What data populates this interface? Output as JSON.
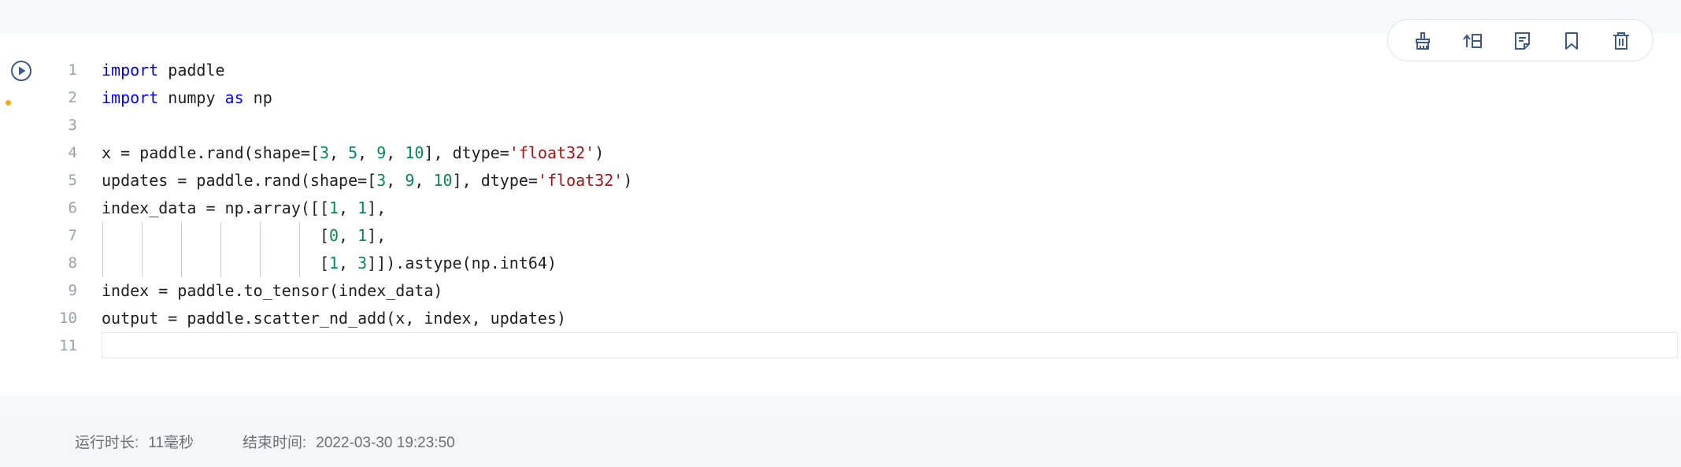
{
  "colors": {
    "accent_dot": "#f5a623",
    "icon": "#3c5a8a",
    "keyword": "#0000ff",
    "number": "#098658",
    "string": "#a31515"
  },
  "toolbar": {
    "buttons": [
      {
        "icon": "broom-icon",
        "name": "clear-output-button"
      },
      {
        "icon": "move-up-icon",
        "name": "move-cell-button"
      },
      {
        "icon": "note-icon",
        "name": "cell-notes-button"
      },
      {
        "icon": "bookmark-icon",
        "name": "bookmark-button"
      },
      {
        "icon": "trash-icon",
        "name": "delete-cell-button"
      }
    ]
  },
  "run_button": {
    "icon": "play-circle-icon"
  },
  "code": {
    "line_numbers": [
      "1",
      "2",
      "3",
      "4",
      "5",
      "6",
      "7",
      "8",
      "9",
      "10",
      "11"
    ],
    "lines": [
      [
        {
          "t": "import",
          "c": "kw"
        },
        {
          "t": " paddle",
          "c": ""
        }
      ],
      [
        {
          "t": "import",
          "c": "kw"
        },
        {
          "t": " numpy ",
          "c": ""
        },
        {
          "t": "as",
          "c": "kw"
        },
        {
          "t": " np",
          "c": ""
        }
      ],
      [],
      [
        {
          "t": "x = paddle.rand(shape=[",
          "c": ""
        },
        {
          "t": "3",
          "c": "num"
        },
        {
          "t": ", ",
          "c": ""
        },
        {
          "t": "5",
          "c": "num"
        },
        {
          "t": ", ",
          "c": ""
        },
        {
          "t": "9",
          "c": "num"
        },
        {
          "t": ", ",
          "c": ""
        },
        {
          "t": "10",
          "c": "num"
        },
        {
          "t": "], dtype=",
          "c": ""
        },
        {
          "t": "'float32'",
          "c": "str"
        },
        {
          "t": ")",
          "c": ""
        }
      ],
      [
        {
          "t": "updates = paddle.rand(shape=[",
          "c": ""
        },
        {
          "t": "3",
          "c": "num"
        },
        {
          "t": ", ",
          "c": ""
        },
        {
          "t": "9",
          "c": "num"
        },
        {
          "t": ", ",
          "c": ""
        },
        {
          "t": "10",
          "c": "num"
        },
        {
          "t": "], dtype=",
          "c": ""
        },
        {
          "t": "'float32'",
          "c": "str"
        },
        {
          "t": ")",
          "c": ""
        }
      ],
      [
        {
          "t": "index_data = np.array([[",
          "c": ""
        },
        {
          "t": "1",
          "c": "num"
        },
        {
          "t": ", ",
          "c": ""
        },
        {
          "t": "1",
          "c": "num"
        },
        {
          "t": "],",
          "c": ""
        }
      ],
      [
        {
          "t": "                       [",
          "c": ""
        },
        {
          "t": "0",
          "c": "num"
        },
        {
          "t": ", ",
          "c": ""
        },
        {
          "t": "1",
          "c": "num"
        },
        {
          "t": "],",
          "c": ""
        }
      ],
      [
        {
          "t": "                       [",
          "c": ""
        },
        {
          "t": "1",
          "c": "num"
        },
        {
          "t": ", ",
          "c": ""
        },
        {
          "t": "3",
          "c": "num"
        },
        {
          "t": "]]).astype(np.int64)",
          "c": ""
        }
      ],
      [
        {
          "t": "index = paddle.to_tensor(index_data)",
          "c": ""
        }
      ],
      [
        {
          "t": "output = paddle.scatter_nd_add(x, index, updates)",
          "c": ""
        }
      ],
      []
    ]
  },
  "footer": {
    "duration_label": "运行时长:",
    "duration_value": "11毫秒",
    "end_time_label": "结束时间:",
    "end_time_value": "2022-03-30 19:23:50"
  }
}
